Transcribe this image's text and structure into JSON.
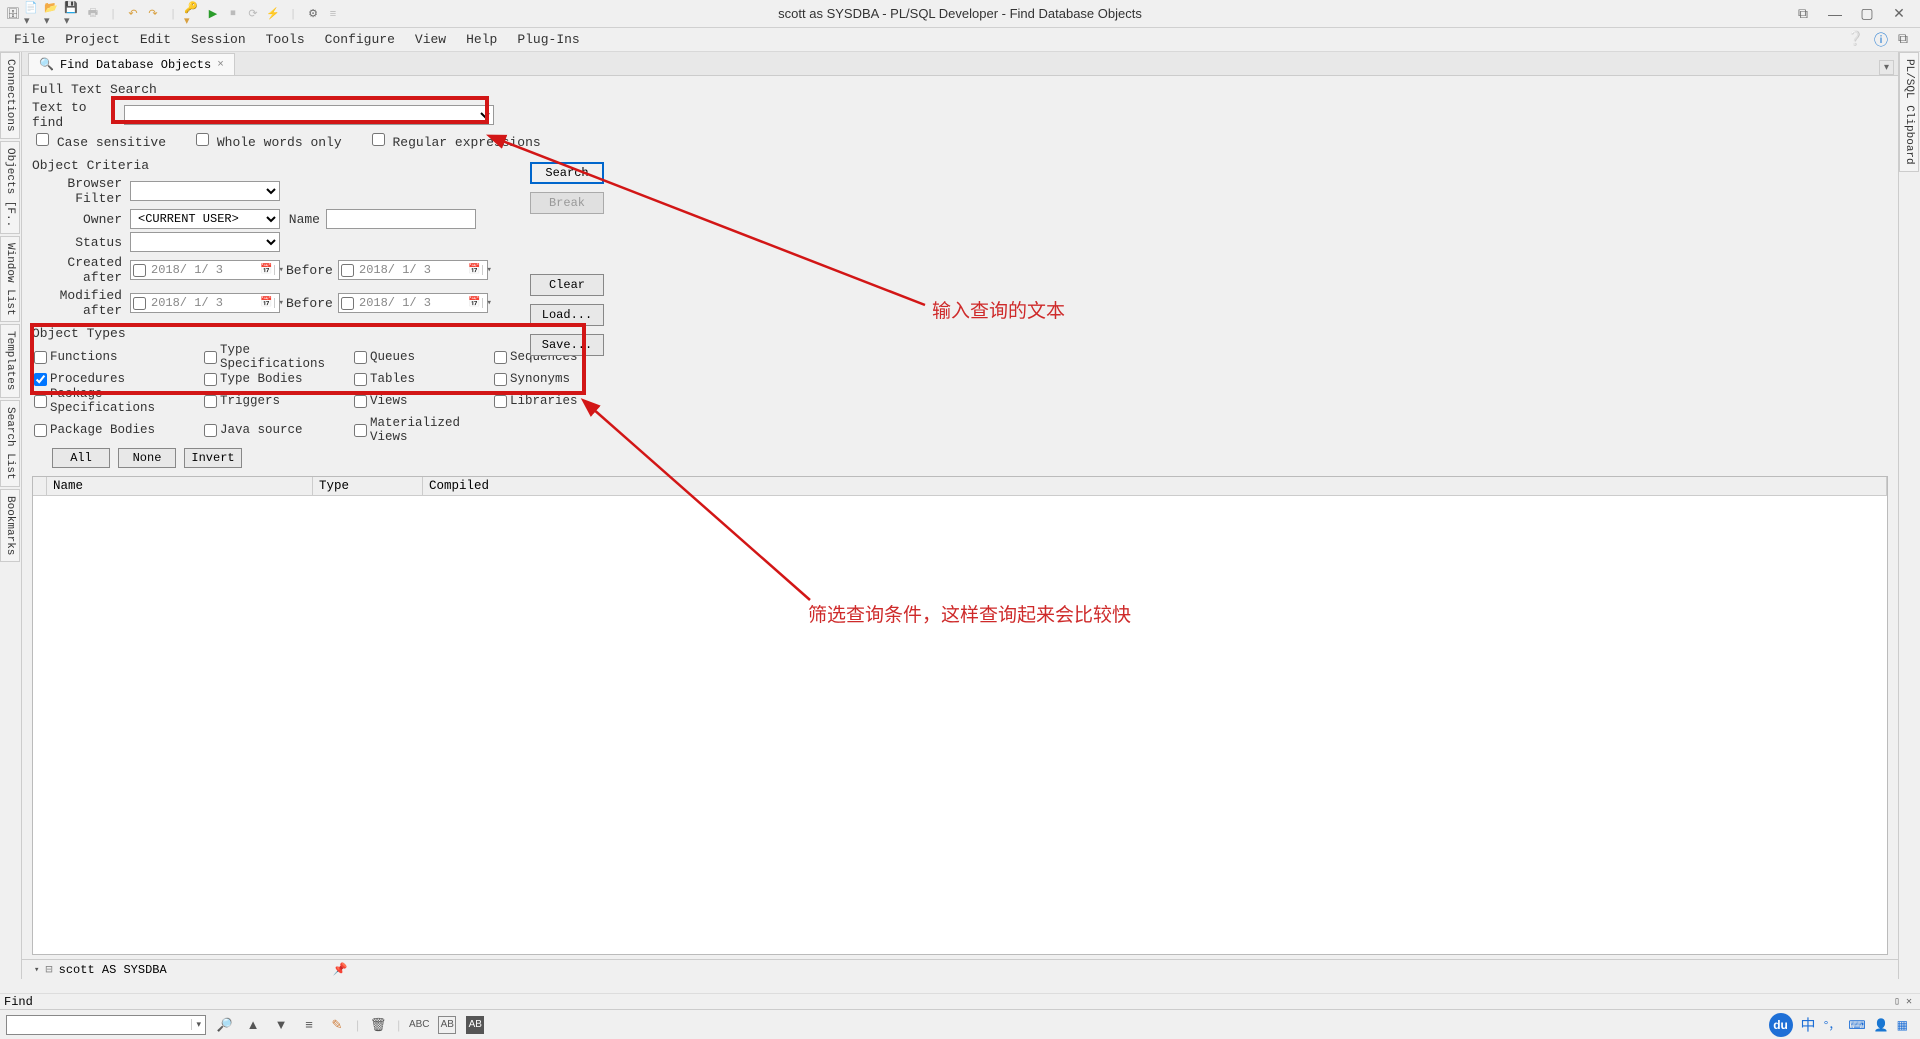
{
  "title": "scott as SYSDBA - PL/SQL Developer - Find Database Objects",
  "menus": [
    "File",
    "Project",
    "Edit",
    "Session",
    "Tools",
    "Configure",
    "View",
    "Help",
    "Plug-Ins"
  ],
  "left_tabs": [
    "Connections",
    "Objects [F..",
    "Window List",
    "Templates",
    "Search List",
    "Bookmarks"
  ],
  "right_tab": "PL/SQL Clipboard",
  "tab": {
    "label": "Find Database Objects",
    "close": "×"
  },
  "form": {
    "full_text_search": "Full Text Search",
    "text_to_find": "Text to find",
    "case_sensitive": "Case sensitive",
    "whole_words": "Whole words only",
    "regex": "Regular expressions",
    "object_criteria": "Object Criteria",
    "browser_filter": "Browser Filter",
    "owner": "Owner",
    "owner_value": "<CURRENT USER>",
    "name": "Name",
    "status": "Status",
    "created_after": "Created after",
    "before": "Before",
    "modified_after": "Modified after",
    "date": "2018/ 1/ 3",
    "object_types": "Object Types"
  },
  "types": {
    "c0": [
      "Functions",
      "Procedures",
      "Package Specifications",
      "Package Bodies"
    ],
    "c1": [
      "Type Specifications",
      "Type Bodies",
      "Triggers",
      "Java source"
    ],
    "c2": [
      "Queues",
      "Tables",
      "Views",
      "Materialized Views"
    ],
    "c3": [
      "Sequences",
      "Synonyms",
      "Libraries"
    ]
  },
  "type_buttons": {
    "all": "All",
    "none": "None",
    "invert": "Invert"
  },
  "side": {
    "search": "Search",
    "break": "Break",
    "clear": "Clear",
    "load": "Load...",
    "save": "Save..."
  },
  "columns": [
    "",
    "Name",
    "Type",
    "Compiled"
  ],
  "conn": "scott AS SYSDBA",
  "find": "Find",
  "anno1": "输入查询的文本",
  "anno2": "筛选查询条件，这样查询起来会比较快",
  "tray_text": "中"
}
